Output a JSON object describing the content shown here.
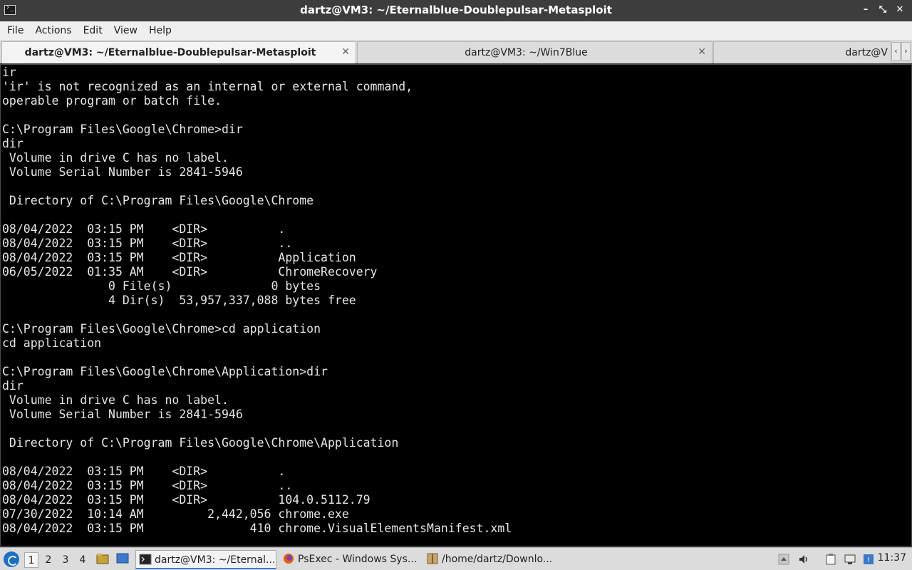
{
  "window": {
    "title": "dartz@VM3: ~/Eternalblue-Doublepulsar-Metasploit",
    "controls": [
      "minimize",
      "restore",
      "close"
    ]
  },
  "menu": [
    "File",
    "Actions",
    "Edit",
    "View",
    "Help"
  ],
  "tabs": [
    {
      "label": "dartz@VM3: ~/Eternalblue-Doublepulsar-Metasploit",
      "active": true
    },
    {
      "label": "dartz@VM3: ~/Win7Blue",
      "active": false
    },
    {
      "label": "dartz@V",
      "active": false
    }
  ],
  "terminal": {
    "lines": [
      "ir",
      "'ir' is not recognized as an internal or external command,",
      "operable program or batch file.",
      "",
      "C:\\Program Files\\Google\\Chrome>dir",
      "dir",
      " Volume in drive C has no label.",
      " Volume Serial Number is 2841-5946",
      "",
      " Directory of C:\\Program Files\\Google\\Chrome",
      "",
      "08/04/2022  03:15 PM    <DIR>          .",
      "08/04/2022  03:15 PM    <DIR>          ..",
      "08/04/2022  03:15 PM    <DIR>          Application",
      "06/05/2022  01:35 AM    <DIR>          ChromeRecovery",
      "               0 File(s)              0 bytes",
      "               4 Dir(s)  53,957,337,088 bytes free",
      "",
      "C:\\Program Files\\Google\\Chrome>cd application",
      "cd application",
      "",
      "C:\\Program Files\\Google\\Chrome\\Application>dir",
      "dir",
      " Volume in drive C has no label.",
      " Volume Serial Number is 2841-5946",
      "",
      " Directory of C:\\Program Files\\Google\\Chrome\\Application",
      "",
      "08/04/2022  03:15 PM    <DIR>          .",
      "08/04/2022  03:15 PM    <DIR>          ..",
      "08/04/2022  03:15 PM    <DIR>          104.0.5112.79",
      "07/30/2022  10:14 AM         2,442,056 chrome.exe",
      "08/04/2022  03:15 PM               410 chrome.VisualElementsManifest.xml"
    ]
  },
  "taskbar": {
    "workspaces": [
      "1",
      "2",
      "3",
      "4"
    ],
    "tasks": [
      {
        "label": "dartz@VM3: ~/Eternal...",
        "icon": "terminal-icon",
        "active": true
      },
      {
        "label": "PsExec - Windows Sys...",
        "icon": "firefox-icon",
        "active": false
      },
      {
        "label": "/home/dartz/Downlo...",
        "icon": "archive-icon",
        "active": false
      }
    ],
    "clock": "11:37",
    "colors": {
      "accent": "#3a7bd5",
      "terminal_bg": "#000000",
      "terminal_fg": "#e6e6e6"
    }
  }
}
